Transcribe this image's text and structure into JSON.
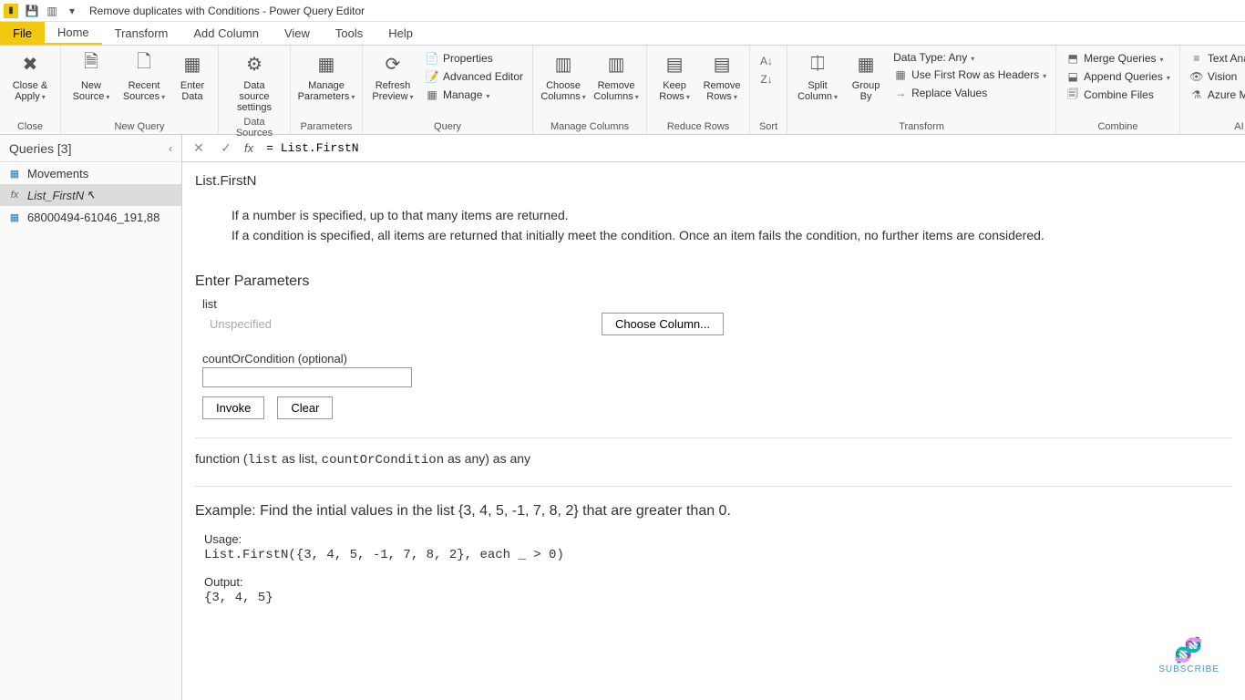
{
  "titlebar": {
    "title": "Remove duplicates with Conditions - Power Query Editor"
  },
  "tabs": {
    "file": "File",
    "home": "Home",
    "transform": "Transform",
    "addcol": "Add Column",
    "view": "View",
    "tools": "Tools",
    "help": "Help"
  },
  "ribbon": {
    "close": {
      "label": "Close &\nApply",
      "group": "Close"
    },
    "newquery": {
      "new": "New\nSource",
      "recent": "Recent\nSources",
      "enter": "Enter\nData",
      "group": "New Query"
    },
    "ds": {
      "label": "Data source\nsettings",
      "group": "Data Sources"
    },
    "params": {
      "label": "Manage\nParameters",
      "group": "Parameters"
    },
    "query": {
      "refresh": "Refresh\nPreview",
      "props": "Properties",
      "adv": "Advanced Editor",
      "manage": "Manage",
      "group": "Query"
    },
    "mcols": {
      "choose": "Choose\nColumns",
      "remove": "Remove\nColumns",
      "group": "Manage Columns"
    },
    "rrows": {
      "keep": "Keep\nRows",
      "remove": "Remove\nRows",
      "group": "Reduce Rows"
    },
    "sort": {
      "group": "Sort"
    },
    "trans": {
      "split": "Split\nColumn",
      "group_btn": "Group\nBy",
      "datatype": "Data Type: Any",
      "firstrow": "Use First Row as Headers",
      "replace": "Replace Values",
      "group": "Transform"
    },
    "combine": {
      "merge": "Merge Queries",
      "append": "Append Queries",
      "files": "Combine Files",
      "group": "Combine"
    },
    "ai": {
      "text": "Text Analytics",
      "vision": "Vision",
      "aml": "Azure Machine Learning",
      "group": "AI Insights"
    }
  },
  "queries": {
    "header": "Queries [3]",
    "items": [
      {
        "label": "Movements",
        "type": "tbl"
      },
      {
        "label": "List_FirstN",
        "type": "fx"
      },
      {
        "label": "68000494-61046_191,88",
        "type": "tbl"
      }
    ]
  },
  "formula": {
    "value": "= List.FirstN"
  },
  "doc": {
    "name": "List.FirstN",
    "desc1": "If a number is specified, up to that many items are returned.",
    "desc2": "If a condition is specified, all items are returned that initially meet the condition. Once an item fails the condition, no further items are considered.",
    "params_title": "Enter Parameters",
    "p1_label": "list",
    "p1_hint": "Unspecified",
    "choose": "Choose Column...",
    "p2_label": "countOrCondition (optional)",
    "invoke": "Invoke",
    "clear": "Clear",
    "sig_pre": "function (",
    "sig_list": "list",
    "sig_mid": " as list, ",
    "sig_cond": "countOrCondition",
    "sig_post": " as any) as any",
    "example": "Example: Find the intial values in the list {3, 4, 5, -1, 7, 8, 2} that are greater than 0.",
    "usage_label": "Usage:",
    "usage_code": "List.FirstN({3, 4, 5, -1, 7, 8, 2}, each _ > 0)",
    "output_label": "Output:",
    "output_code": "{3, 4, 5}"
  },
  "subscribe": "SUBSCRIBE"
}
